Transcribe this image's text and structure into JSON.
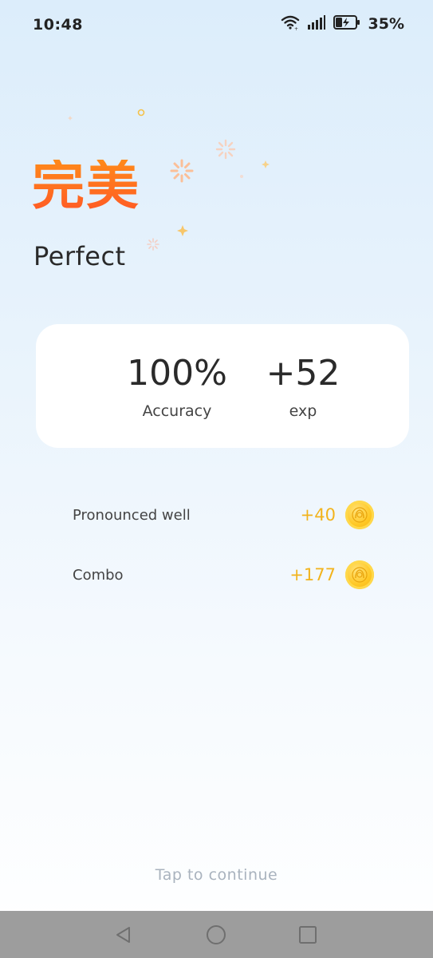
{
  "status_bar": {
    "time": "10:48",
    "battery": "35%",
    "icons": [
      "wifi-icon",
      "signal-icon",
      "battery-charging-icon"
    ]
  },
  "result": {
    "title_cn": "完美",
    "title_en": "Perfect",
    "title_color": "#ff6a1f"
  },
  "stats": {
    "accuracy_value": "100%",
    "accuracy_label": "Accuracy",
    "exp_value": "+52",
    "exp_label": "exp"
  },
  "rewards": [
    {
      "label": "Pronounced well",
      "amount": "+40",
      "icon": "coin-icon"
    },
    {
      "label": "Combo",
      "amount": "+177",
      "icon": "coin-icon"
    }
  ],
  "reward_color": "#f2b31c",
  "continue_text": "Tap to continue",
  "nav_bar": {
    "icons": [
      "back-icon",
      "home-icon",
      "recent-apps-icon"
    ]
  }
}
